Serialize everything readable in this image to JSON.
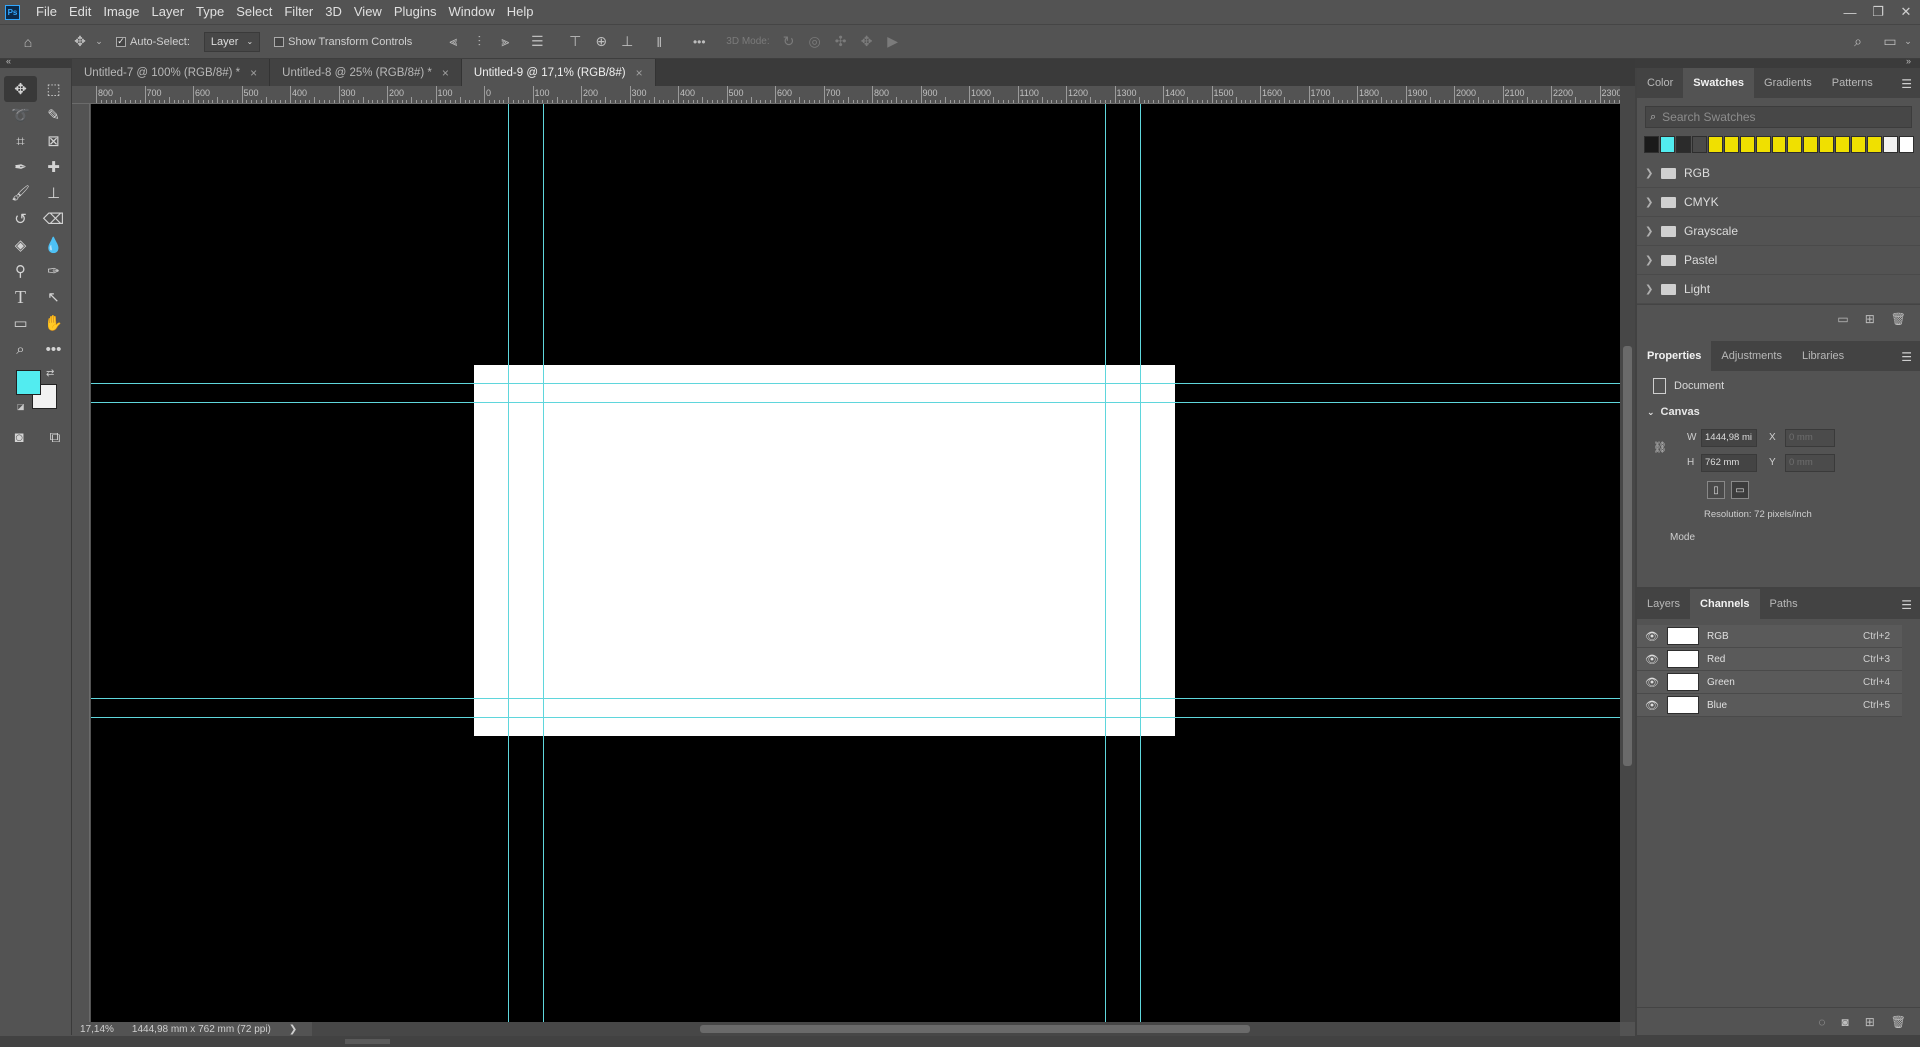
{
  "app": {
    "logo": "Ps",
    "menu": [
      "File",
      "Edit",
      "Image",
      "Layer",
      "Type",
      "Select",
      "Filter",
      "3D",
      "View",
      "Plugins",
      "Window",
      "Help"
    ],
    "window_controls": [
      "—",
      "❐",
      "✕"
    ]
  },
  "options": {
    "auto_select_label": "Auto-Select:",
    "auto_select_checked": "✓",
    "layer_select": "Layer",
    "show_transform_label": "Show Transform Controls",
    "mode_3d_label": "3D Mode:",
    "more": "•••"
  },
  "tabs": [
    {
      "label": "Untitled-7 @ 100% (RGB/8#) *",
      "close": "×"
    },
    {
      "label": "Untitled-8 @ 25% (RGB/8#) *",
      "close": "×"
    },
    {
      "label": "Untitled-9 @ 17,1% (RGB/8#)",
      "close": "×"
    }
  ],
  "ruler_h_labels": [
    "800",
    "700",
    "600",
    "500",
    "400",
    "300",
    "200",
    "100",
    "0",
    "100",
    "200",
    "300",
    "400",
    "500",
    "600",
    "700",
    "800",
    "900",
    "1000",
    "1100",
    "1200",
    "1300",
    "1400",
    "1500",
    "1600",
    "1700",
    "1800",
    "1900",
    "2000",
    "2100",
    "2200",
    "2300"
  ],
  "status": {
    "zoom": "17,14%",
    "doc_info": "1444,98 mm x 762 mm (72 ppi)",
    "arrow": "❯"
  },
  "colors": {
    "foreground": "#52ecf0",
    "background": "#f2f2f2",
    "guides": "#5fd6dc"
  },
  "swatches_panel": {
    "tabs": [
      "Color",
      "Swatches",
      "Gradients",
      "Patterns"
    ],
    "active_tab": "Swatches",
    "search_placeholder": "Search Swatches",
    "recent": [
      "#1a1a1a",
      "#52ecf0",
      "#2b2b2b",
      "#4a4a4a",
      "#f0e000",
      "#f0e000",
      "#f0e000",
      "#f0e000",
      "#f0e000",
      "#f0e000",
      "#f0e000",
      "#f0e000",
      "#f0e000",
      "#f0e000",
      "#f0e000",
      "#f2f2f2",
      "#ffffff"
    ],
    "folders": [
      "RGB",
      "CMYK",
      "Grayscale",
      "Pastel",
      "Light"
    ]
  },
  "properties_panel": {
    "tabs": [
      "Properties",
      "Adjustments",
      "Libraries"
    ],
    "active_tab": "Properties",
    "kind": "Document",
    "section": "Canvas",
    "w_label": "W",
    "w_value": "1444,98 mi",
    "h_label": "H",
    "h_value": "762 mm",
    "x_label": "X",
    "x_value": "0 mm",
    "y_label": "Y",
    "y_value": "0 mm",
    "resolution": "Resolution: 72 pixels/inch",
    "mode_label": "Mode"
  },
  "channels_panel": {
    "tabs": [
      "Layers",
      "Channels",
      "Paths"
    ],
    "active_tab": "Channels",
    "channels": [
      {
        "name": "RGB",
        "shortcut": "Ctrl+2"
      },
      {
        "name": "Red",
        "shortcut": "Ctrl+3"
      },
      {
        "name": "Green",
        "shortcut": "Ctrl+4"
      },
      {
        "name": "Blue",
        "shortcut": "Ctrl+5"
      }
    ]
  }
}
